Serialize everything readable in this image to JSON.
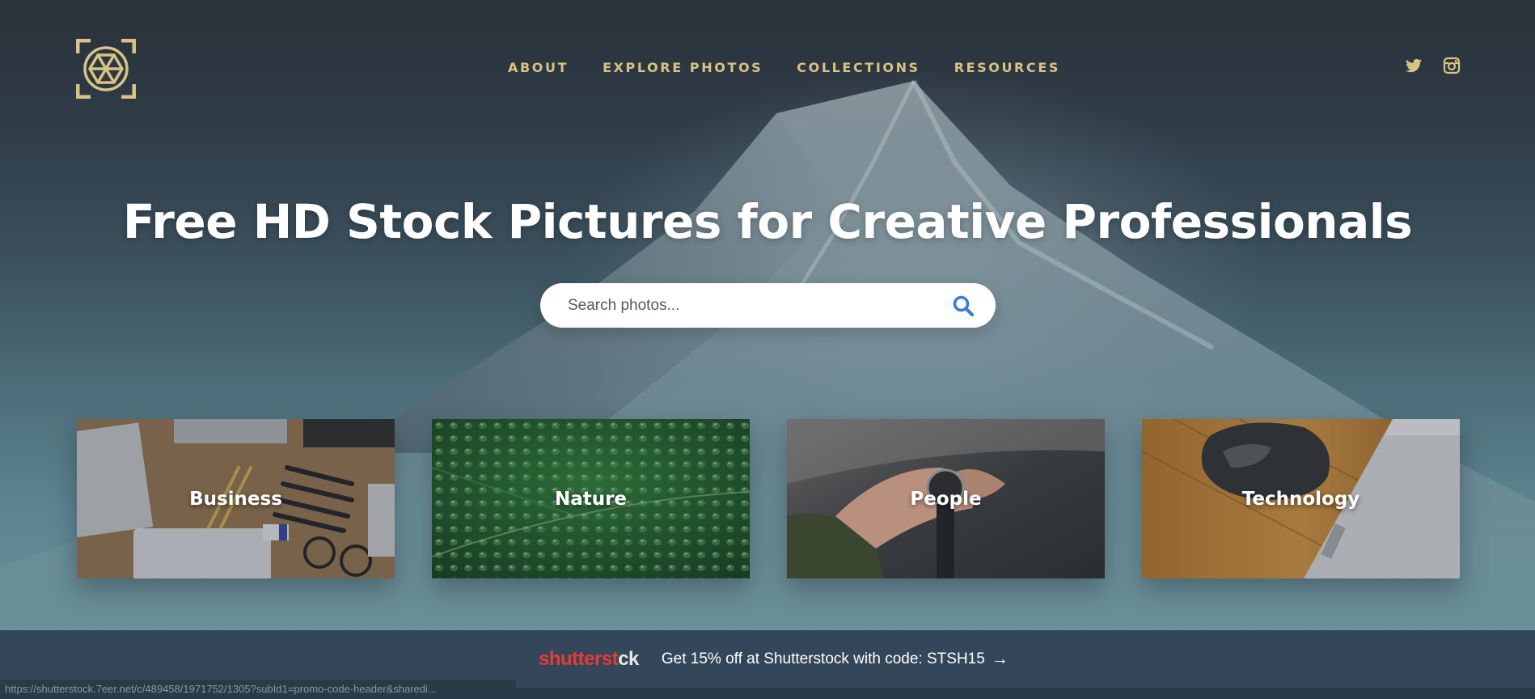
{
  "nav": {
    "items": [
      {
        "label": "ABOUT"
      },
      {
        "label": "EXPLORE PHOTOS"
      },
      {
        "label": "COLLECTIONS"
      },
      {
        "label": "RESOURCES"
      }
    ],
    "social": [
      "twitter-icon",
      "instagram-icon"
    ]
  },
  "hero": {
    "title": "Free HD Stock Pictures for Creative Professionals"
  },
  "search": {
    "placeholder": "Search photos...",
    "value": ""
  },
  "categories": [
    {
      "label": "Business"
    },
    {
      "label": "Nature"
    },
    {
      "label": "People"
    },
    {
      "label": "Technology"
    }
  ],
  "promo": {
    "brand_main": "shutterst",
    "brand_tail": "ck",
    "text": "Get 15% off at Shutterstock with code: STSH15",
    "arrow": "→"
  },
  "status_url": "https://shutterstock.7eer.net/c/489458/1971752/1305?subId1=promo-code-header&sharedi...",
  "colors": {
    "accent": "#d8c383",
    "search_icon": "#3a7bd5",
    "promo_bg": "#34475a",
    "brand_red": "#e63a36"
  }
}
